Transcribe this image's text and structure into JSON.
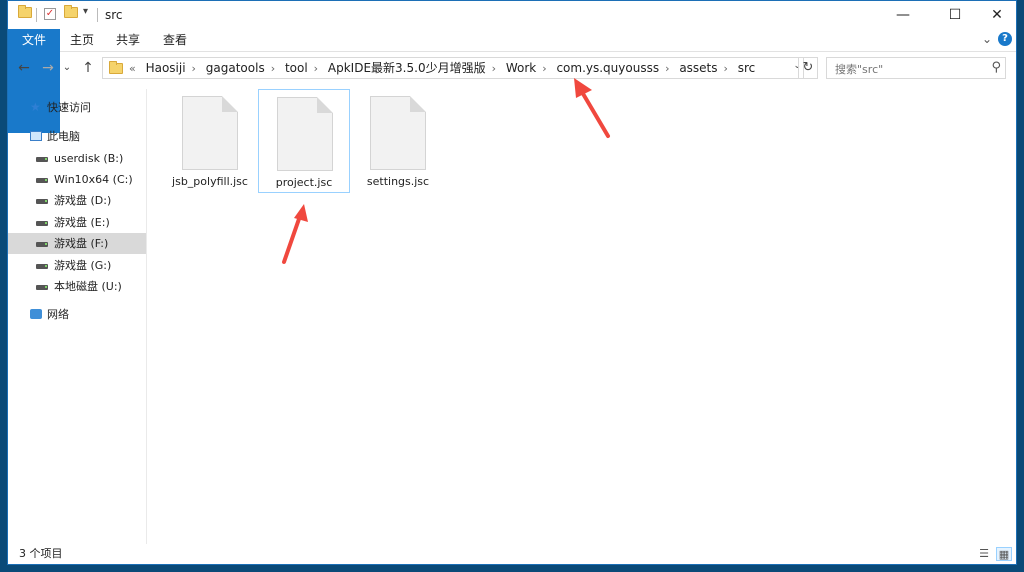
{
  "window": {
    "title": "src"
  },
  "window_controls": {
    "minimize": "—",
    "maximize": "☐",
    "close": "✕"
  },
  "ribbon": {
    "tabs": [
      {
        "label": "文件"
      },
      {
        "label": "主页"
      },
      {
        "label": "共享"
      },
      {
        "label": "查看"
      }
    ],
    "expand_glyph": "⌄",
    "help_glyph": "?"
  },
  "nav": {
    "back": "←",
    "forward": "→",
    "recent": "⌄",
    "up": "↑",
    "overflow": "«",
    "breadcrumbs": [
      {
        "label": "Haosiji"
      },
      {
        "label": "gagatools"
      },
      {
        "label": "tool"
      },
      {
        "label": "ApkIDE最新3.5.0少月增强版"
      },
      {
        "label": "Work"
      },
      {
        "label": "com.ys.quyousss"
      },
      {
        "label": "assets"
      },
      {
        "label": "src"
      }
    ],
    "separator": "›",
    "refresh": "↻",
    "dropdown": "⌄"
  },
  "search": {
    "placeholder": "搜索\"src\"",
    "icon_glyph": "⚲"
  },
  "sidebar": {
    "quick_access": "快速访问",
    "this_pc": "此电脑",
    "drives": [
      {
        "label": "userdisk (B:)"
      },
      {
        "label": "Win10x64 (C:)"
      },
      {
        "label": "游戏盘 (D:)"
      },
      {
        "label": "游戏盘 (E:)"
      },
      {
        "label": "游戏盘 (F:)"
      },
      {
        "label": "游戏盘 (G:)"
      },
      {
        "label": "本地磁盘 (U:)"
      }
    ],
    "network": "网络"
  },
  "files": [
    {
      "name": "jsb_polyfill.jsc"
    },
    {
      "name": "project.jsc"
    },
    {
      "name": "settings.jsc"
    }
  ],
  "status": {
    "count": "3 个项目"
  },
  "colors": {
    "accent": "#1979ca",
    "arrow": "#f0483e",
    "selection": "#99d1ff"
  }
}
